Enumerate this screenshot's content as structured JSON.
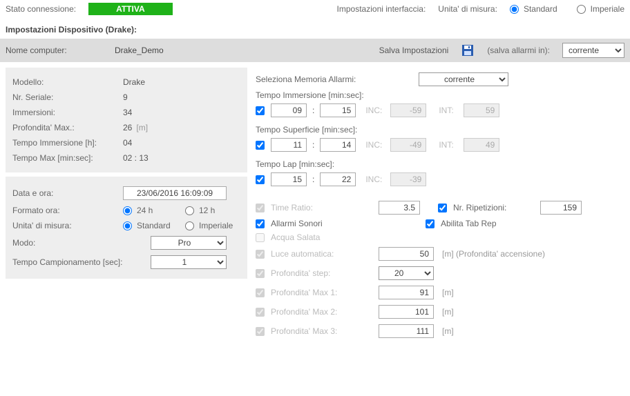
{
  "top": {
    "status_label": "Stato connessione:",
    "status_value": "ATTIVA",
    "iface_label": "Impostazioni interfaccia:",
    "unit_label": "Unita' di misura:",
    "unit_std": "Standard",
    "unit_imp": "Imperiale"
  },
  "section_title": "Impostazioni Dispositivo (Drake):",
  "name_row": {
    "label": "Nome computer:",
    "value": "Drake_Demo",
    "save_btn": "Salva Impostazioni",
    "save_in_label": "(salva allarmi in):",
    "save_in_value": "corrente"
  },
  "info": {
    "model_l": "Modello:",
    "model_v": "Drake",
    "serial_l": "Nr. Seriale:",
    "serial_v": "9",
    "dives_l": "Immersioni:",
    "dives_v": "34",
    "depth_l": "Profondita' Max.:",
    "depth_v": "26",
    "depth_u": "[m]",
    "divetime_l": "Tempo Immersione [h]:",
    "divetime_v": "04",
    "maxtime_l": "Tempo Max [min:sec]:",
    "maxtime_v": "02 : 13"
  },
  "dt": {
    "date_l": "Data e ora:",
    "date_v": "23/06/2016 16:09:09",
    "fmt_l": "Formato ora:",
    "fmt_24": "24 h",
    "fmt_12": "12 h",
    "unit_l": "Unita' di misura:",
    "unit_std": "Standard",
    "unit_imp": "Imperiale",
    "mode_l": "Modo:",
    "mode_v": "Pro",
    "samp_l": "Tempo Campionamento [sec]:",
    "samp_v": "1"
  },
  "alarms": {
    "mem_l": "Seleziona Memoria Allarmi:",
    "mem_v": "corrente",
    "dive_l": "Tempo Immersione [min:sec]:",
    "dive_m": "09",
    "dive_s": "15",
    "dive_inc": "-59",
    "dive_int": "59",
    "surf_l": "Tempo Superficie [min:sec]:",
    "surf_m": "11",
    "surf_s": "14",
    "surf_inc": "-49",
    "surf_int": "49",
    "lap_l": "Tempo Lap [min:sec]:",
    "lap_m": "15",
    "lap_s": "22",
    "lap_inc": "-39",
    "inc_l": "INC:",
    "int_l": "INT:",
    "time_ratio_l": "Time Ratio:",
    "time_ratio_v": "3.5",
    "reps_l": "Nr. Ripetizioni:",
    "reps_v": "159",
    "sound_l": "Allarmi Sonori",
    "tabrep_l": "Abilita Tab Rep",
    "salt_l": "Acqua Salata",
    "autolight_l": "Luce automatica:",
    "autolight_v": "50",
    "autolight_u": "[m]  (Profondita' accensione)",
    "step_l": "Profondita' step:",
    "step_v": "20",
    "p1_l": "Profondita' Max 1:",
    "p1_v": "91",
    "p2_l": "Profondita' Max 2:",
    "p2_v": "101",
    "p3_l": "Profondita' Max 3:",
    "p3_v": "111",
    "m_unit": "[m]"
  }
}
